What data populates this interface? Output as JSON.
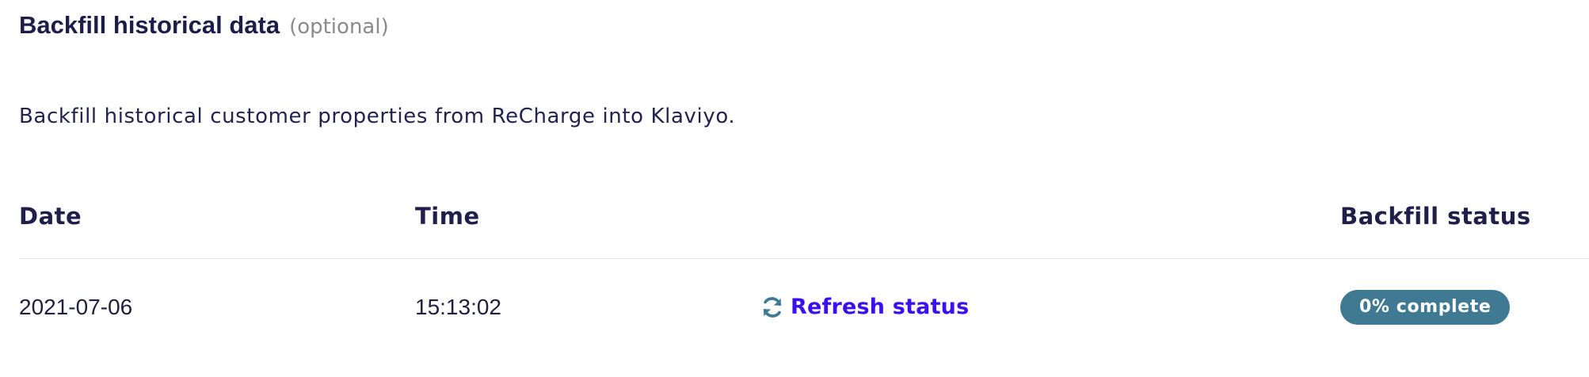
{
  "section": {
    "title": "Backfill historical data",
    "optional_label": "(optional)",
    "description": "Backfill historical customer properties from ReCharge into Klaviyo."
  },
  "table": {
    "columns": {
      "date": "Date",
      "time": "Time",
      "status": "Backfill status"
    },
    "rows": [
      {
        "date": "2021-07-06",
        "time": "15:13:02",
        "refresh_label": "Refresh status",
        "refresh_icon": "refresh-icon",
        "status": "0% complete"
      }
    ]
  },
  "colors": {
    "link": "#3a0ff0",
    "refresh_icon": "#3f7a92",
    "badge_bg": "#3f7a92",
    "badge_text": "#ffffff"
  }
}
